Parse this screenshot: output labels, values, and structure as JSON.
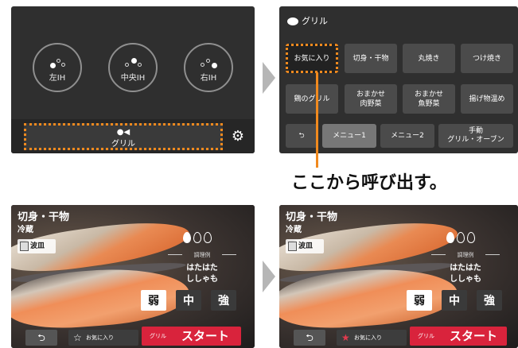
{
  "colors": {
    "accent": "#f18a1e",
    "start": "#d9233c",
    "panel": "#2f2f2f",
    "button": "#4b4b4b"
  },
  "panel1": {
    "burners": [
      {
        "label": "左IH",
        "active_dot": "left"
      },
      {
        "label": "中央IH",
        "active_dot": "center"
      },
      {
        "label": "右IH",
        "active_dot": "right"
      }
    ],
    "grill_button": {
      "icon": "fish-icon",
      "label": "グリル"
    },
    "settings_icon": "gear-icon"
  },
  "panel2": {
    "header": {
      "icon": "fish-icon",
      "title": "グリル"
    },
    "menu": [
      "お気に入り",
      "切身・干物",
      "丸焼き",
      "つけ焼き",
      "鶏のグリル",
      "おまかせ\n肉野菜",
      "おまかせ\n魚野菜",
      "揚げ物温め"
    ],
    "tabs": [
      {
        "label": "メニュー1",
        "active": true
      },
      {
        "label": "メニュー2",
        "active": false
      },
      {
        "label": "手動\nグリル・オーブン",
        "active": false
      }
    ],
    "back_icon": "back-arrow-icon"
  },
  "caption": "ここから呼び出す。",
  "cook_screen": {
    "title": "切身・干物",
    "mode": "冷蔵",
    "dish": "波皿",
    "doneness_level": 1,
    "doneness_max": 3,
    "examples_header": "調理例",
    "examples": [
      "はたはた",
      "ししゃも"
    ],
    "levels": [
      "弱",
      "中",
      "強"
    ],
    "selected_level": "弱",
    "back_icon": "back-arrow-icon",
    "favorite_label": "お気に入り",
    "start_prefix": "グリル",
    "start_label": "スタート"
  },
  "cook_screen_after": {
    "favorite_on": true
  }
}
